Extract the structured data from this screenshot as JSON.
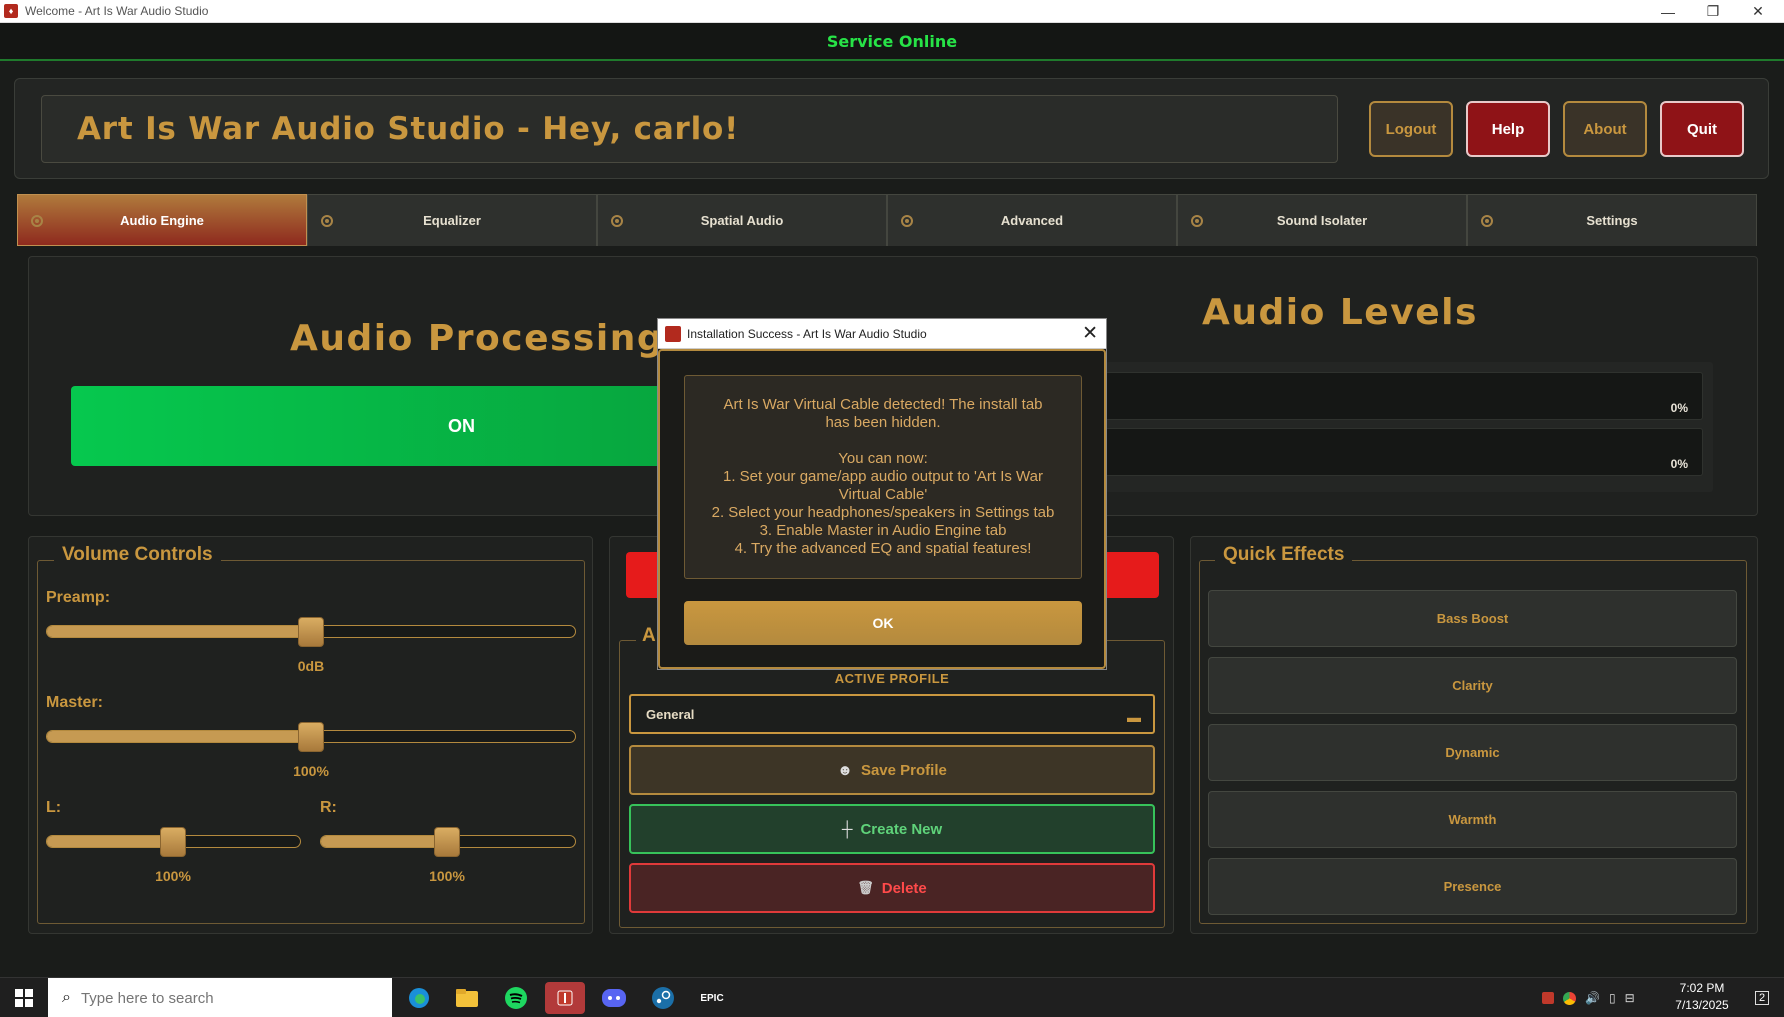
{
  "window": {
    "title": "Welcome - Art Is War Audio Studio",
    "minimize": "—",
    "maximize": "❐",
    "close": "✕"
  },
  "status": {
    "service": "Service Online"
  },
  "header": {
    "title": "Art Is War Audio Studio - Hey, carlo!",
    "logout": "Logout",
    "help": "Help",
    "about": "About",
    "quit": "Quit"
  },
  "tabs": [
    {
      "label": "Audio Engine",
      "active": true
    },
    {
      "label": "Equalizer"
    },
    {
      "label": "Spatial Audio"
    },
    {
      "label": "Advanced"
    },
    {
      "label": "Sound Isolater"
    },
    {
      "label": "Settings"
    }
  ],
  "audio_processing": {
    "title": "Audio Processing",
    "toggle": "ON"
  },
  "audio_levels": {
    "title": "Audio Levels",
    "left_level": "0%",
    "right_level": "0%"
  },
  "volume": {
    "title": "Volume Controls",
    "preamp": {
      "label": "Preamp:",
      "value": "0dB",
      "position": 0.5
    },
    "master": {
      "label": "Master:",
      "value": "100%",
      "position": 0.5
    },
    "left": {
      "label": "L:",
      "value": "100%",
      "position": 0.5
    },
    "right": {
      "label": "R:",
      "value": "100%",
      "position": 0.5
    }
  },
  "profile": {
    "legend_partial": "A",
    "active_label": "ACTIVE PROFILE",
    "selected": "General",
    "caret": "▬",
    "save": "Save Profile",
    "create": "Create New",
    "delete": "Delete",
    "save_icon": "☻",
    "create_icon": "┼",
    "delete_icon": "🗑"
  },
  "quick_effects": {
    "title": "Quick Effects",
    "items": [
      "Bass Boost",
      "Clarity",
      "Dynamic",
      "Warmth",
      "Presence"
    ]
  },
  "dialog": {
    "title": "Installation Success - Art Is War Audio Studio",
    "message": "Art Is War Virtual Cable detected! The install tab\nhas been hidden.\n\nYou can now:\n1. Set your game/app audio output to 'Art Is War\nVirtual Cable'\n2. Select your headphones/speakers in Settings tab\n3. Enable Master in Audio Engine tab\n4. Try the advanced EQ and spatial features!",
    "ok": "OK",
    "close": "✕"
  },
  "taskbar": {
    "search_placeholder": "Type here to search",
    "epic": "EPIC",
    "time": "7:02 PM",
    "date": "7/13/2025",
    "notifications": "2"
  },
  "colors": {
    "gold": "#c9973f",
    "green": "#27e347",
    "red": "#8f1317",
    "on_green": "#06c84e"
  }
}
